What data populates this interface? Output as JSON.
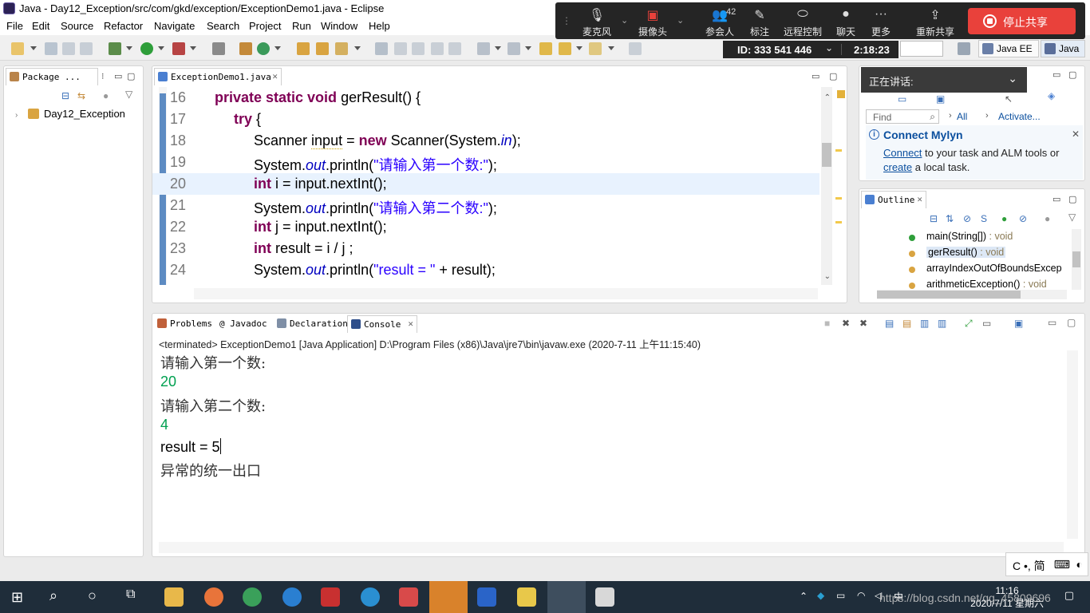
{
  "window": {
    "title": "Java - Day12_Exception/src/com/gkd/exception/ExceptionDemo1.java - Eclipse",
    "menu": [
      "File",
      "Edit",
      "Source",
      "Refactor",
      "Navigate",
      "Search",
      "Project",
      "Run",
      "Window",
      "Help"
    ]
  },
  "perspectives": {
    "java_ee": "Java EE",
    "java": "Java"
  },
  "meeting": {
    "buttons": [
      {
        "label": "麦克风",
        "icon": "microphone-icon"
      },
      {
        "label": "摄像头",
        "icon": "camera-off-icon"
      },
      {
        "label": "参会人",
        "icon": "participants-icon",
        "count": "42"
      },
      {
        "label": "标注",
        "icon": "annotate-icon"
      },
      {
        "label": "远程控制",
        "icon": "remote-control-icon"
      },
      {
        "label": "聊天",
        "icon": "chat-icon"
      },
      {
        "label": "更多",
        "icon": "more-icon"
      },
      {
        "label": "重新共享",
        "icon": "reshare-icon"
      }
    ],
    "stop_share": "停止共享",
    "meeting_id": "ID: 333 541 446",
    "duration": "2:18:23",
    "speaking_label": "正在讲话:"
  },
  "package_explorer": {
    "tab_label": "Package ...",
    "project": "Day12_Exception"
  },
  "editor": {
    "tab_label": "ExceptionDemo1.java",
    "lines": [
      {
        "num": "16",
        "indent": 1,
        "html": "<span class=\"kw\">private static void</span> gerResult() {"
      },
      {
        "num": "17",
        "indent": 2,
        "html": "<span class=\"kw\">try</span> {"
      },
      {
        "num": "18",
        "indent": 3,
        "html": "Scanner <span class=\"warnu\">input</span> = <span class=\"kw\">new</span> Scanner(System.<span class=\"fld\">in</span>);"
      },
      {
        "num": "19",
        "indent": 3,
        "html": "System.<span class=\"fld\">out</span>.println(<span class=\"str\">\"请输入第一个数:\"</span>);"
      },
      {
        "num": "20",
        "indent": 3,
        "html": "<span class=\"kw\">int</span> i = input.nextInt();",
        "current": true
      },
      {
        "num": "21",
        "indent": 3,
        "html": "System.<span class=\"fld\">out</span>.println(<span class=\"str\">\"请输入第二个数:\"</span>);"
      },
      {
        "num": "22",
        "indent": 3,
        "html": "<span class=\"kw\">int</span> j = input.nextInt();"
      },
      {
        "num": "23",
        "indent": 3,
        "html": "<span class=\"kw\">int</span> result = i / j ;"
      },
      {
        "num": "24",
        "indent": 3,
        "html": "System.<span class=\"fld\">out</span>.println(<span class=\"str\">\"result = \"</span> + result);"
      }
    ]
  },
  "task_panel": {
    "find_placeholder": "Find",
    "all_label": "All",
    "activate_label": "Activate...",
    "mylyn_title": "Connect Mylyn",
    "mylyn_connect": "Connect",
    "mylyn_text1": " to your task and ALM tools or ",
    "mylyn_create": "create",
    "mylyn_text2": " a local task."
  },
  "outline": {
    "tab_label": "Outline",
    "items": [
      {
        "name": "main(String[])",
        "ret": " : void",
        "selected": false
      },
      {
        "name": "gerResult()",
        "ret": " : void",
        "selected": true
      },
      {
        "name": "arrayIndexOutOfBoundsExcep",
        "ret": "",
        "selected": false
      },
      {
        "name": "arithmeticException()",
        "ret": " : void",
        "selected": false
      }
    ]
  },
  "bottom_tabs": [
    "Problems",
    "@ Javadoc",
    "Declaration",
    "Console"
  ],
  "console": {
    "meta": "<terminated> ExceptionDemo1 [Java Application] D:\\Program Files (x86)\\Java\\jre7\\bin\\javaw.exe (2020-7-11 上午11:15:40)",
    "lines": [
      {
        "text": "请输入第一个数:",
        "kind": "cjk"
      },
      {
        "text": "20",
        "kind": "input"
      },
      {
        "text": "请输入第二个数:",
        "kind": "cjk"
      },
      {
        "text": "4",
        "kind": "input"
      },
      {
        "text": "result = 5",
        "kind": "plain",
        "caret": true
      },
      {
        "text": "异常的统一出口",
        "kind": "cjk"
      }
    ]
  },
  "ime": "C •, 简",
  "taskbar": {
    "clock_time": "11:16",
    "clock_date": "2020/7/11 星期六",
    "tray_lang": "中",
    "watermark": "https://blog.csdn.net/qq_45809696"
  }
}
